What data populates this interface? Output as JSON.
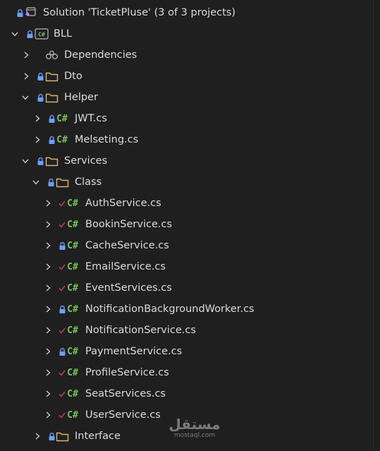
{
  "solution": {
    "label": "Solution 'TicketPluse' (3 of 3 projects)"
  },
  "bll": {
    "label": "BLL",
    "icon": "csharp-project-icon"
  },
  "dependencies": {
    "label": "Dependencies"
  },
  "dto": {
    "label": "Dto"
  },
  "helper": {
    "label": "Helper",
    "files": [
      {
        "label": "JWT.cs",
        "status": "locked"
      },
      {
        "label": "Melseting.cs",
        "status": "locked"
      }
    ]
  },
  "services": {
    "label": "Services"
  },
  "class_folder": {
    "label": "Class",
    "files": [
      {
        "label": "AuthService.cs",
        "status": "checked-in"
      },
      {
        "label": "BookinService.cs",
        "status": "checked-in"
      },
      {
        "label": "CacheService.cs",
        "status": "locked"
      },
      {
        "label": "EmailService.cs",
        "status": "checked-in"
      },
      {
        "label": "EventServices.cs",
        "status": "checked-in"
      },
      {
        "label": "NotificationBackgroundWorker.cs",
        "status": "locked"
      },
      {
        "label": "NotificationService.cs",
        "status": "checked-in"
      },
      {
        "label": "PaymentService.cs",
        "status": "locked"
      },
      {
        "label": "ProfileService.cs",
        "status": "checked-in"
      },
      {
        "label": "SeatServices.cs",
        "status": "checked-in"
      },
      {
        "label": "UserService.cs",
        "status": "checked-in"
      }
    ]
  },
  "interface_folder": {
    "label": "Interface"
  },
  "cs_badge": "C#",
  "colors": {
    "background": "#1f1f1f",
    "text": "#dcdcdc",
    "chevron": "#c8c8c8",
    "lock": "#6aa0ff",
    "check": "#c0394a",
    "csharp": "#78c25a",
    "folder": "#d8b56a",
    "solution": "#b58cf0"
  },
  "watermark": {
    "arabic": "مستقل",
    "latin": "mostaql.com"
  }
}
